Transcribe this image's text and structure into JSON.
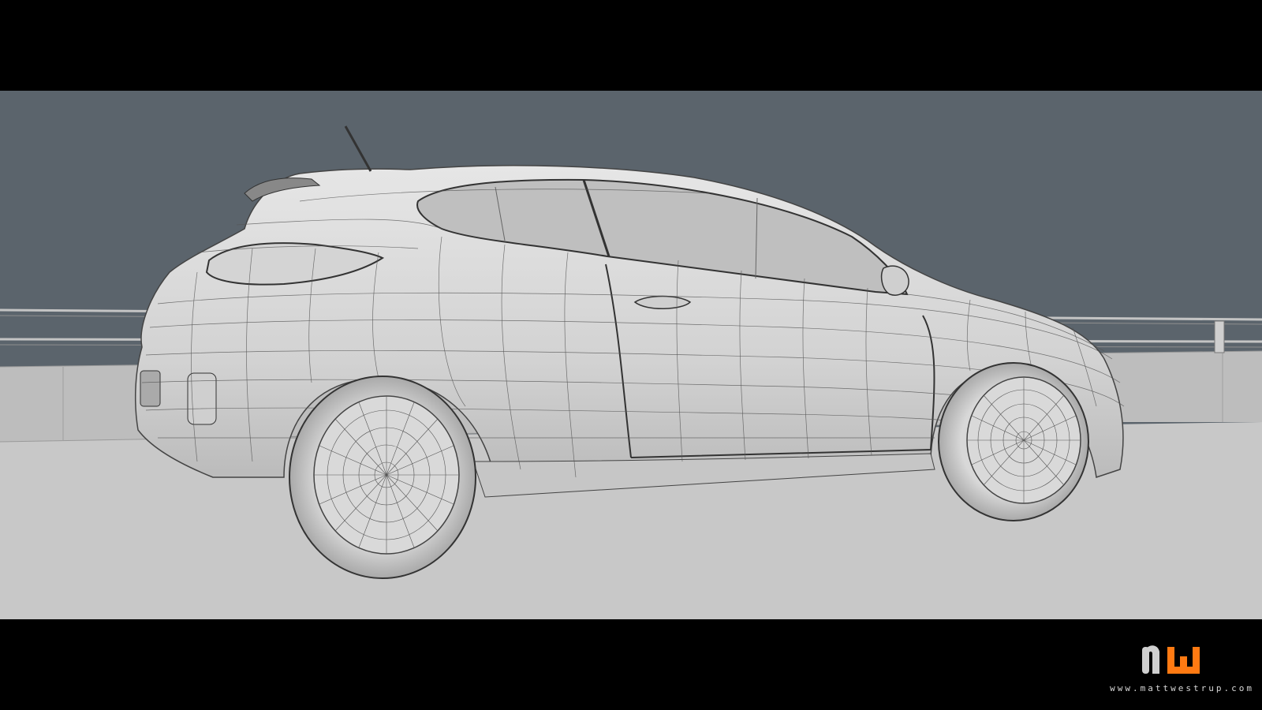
{
  "scene": {
    "subject": "car-wireframe",
    "colors": {
      "background": "#5b646c",
      "ground": "#c8c8c8",
      "barrier": "#bdbdbd",
      "body": "#d9d9d9",
      "glass": "#bfbfbf",
      "wire": "#555555",
      "letterbox": "#000000"
    }
  },
  "branding": {
    "logo_text": "mw",
    "logo_colors": {
      "primary": "#cfcfcf",
      "accent": "#ff7a12"
    },
    "site_url": "www.mattwestrup.com"
  }
}
